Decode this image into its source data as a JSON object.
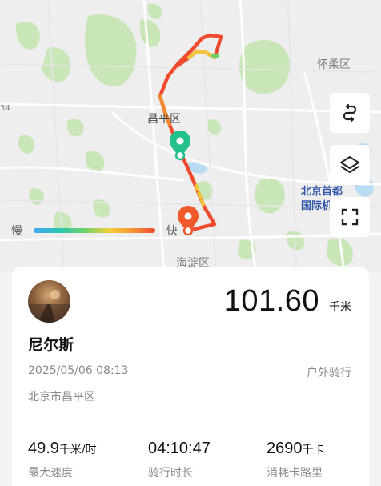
{
  "map": {
    "labels": {
      "huairou": "怀柔区",
      "changping": "昌平区",
      "haidian": "海淀区",
      "airport_line1": "北京首都",
      "airport_line2": "国际机",
      "scale_number": "34"
    },
    "speed_legend": {
      "slow": "慢",
      "fast": "快",
      "colors": [
        "#3fa6f2",
        "#2cc6b0",
        "#6fd26a",
        "#f2cf3a",
        "#f59a34",
        "#f14a2f"
      ]
    },
    "buttons": {
      "route_icon": "route-icon",
      "layers_icon": "layers-icon",
      "fullscreen_icon": "fullscreen-icon"
    },
    "colors": {
      "route": "#f04a2e",
      "start_marker": "#22c08a",
      "end_marker": "#f05a2a",
      "green_area": "#c9e6b8"
    }
  },
  "ride": {
    "username": "尼尔斯",
    "distance": "101.60",
    "distance_unit": "千米",
    "datetime": "2025/05/06 08:13",
    "activity_type": "户外骑行",
    "location": "北京市昌平区",
    "stats": [
      {
        "value": "49.9",
        "unit": "千米/时",
        "label": "最大速度"
      },
      {
        "value": "04:10:47",
        "unit": "",
        "label": "骑行时长"
      },
      {
        "value": "2690",
        "unit": "千卡",
        "label": "消耗卡路里"
      }
    ]
  }
}
